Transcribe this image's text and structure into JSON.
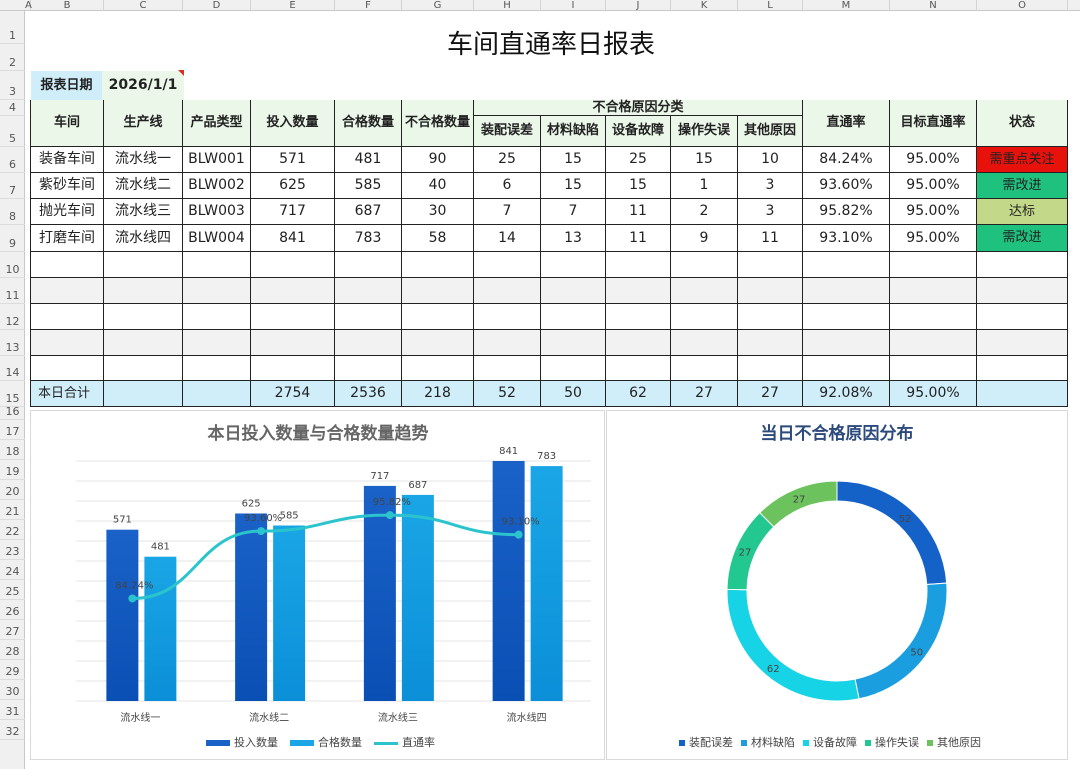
{
  "column_letters": [
    "A",
    "B",
    "C",
    "D",
    "E",
    "F",
    "G",
    "H",
    "I",
    "J",
    "K",
    "L",
    "M",
    "N",
    "O"
  ],
  "row_numbers": [
    "1",
    "2",
    "3",
    "4",
    "5",
    "6",
    "7",
    "8",
    "9",
    "10",
    "11",
    "12",
    "13",
    "14",
    "15",
    "16",
    "17",
    "18",
    "19",
    "20",
    "21",
    "22",
    "23",
    "24",
    "25",
    "26",
    "27",
    "28",
    "29",
    "30",
    "31",
    "32"
  ],
  "title": "车间直通率日报表",
  "report_date_label": "报表日期",
  "report_date_value": "2026/1/1",
  "headers": {
    "workshop": "车间",
    "line": "生产线",
    "product": "产品类型",
    "input": "投入数量",
    "qualified": "合格数量",
    "defect": "不合格数量",
    "reason_group": "不合格原因分类",
    "reasons": [
      "装配误差",
      "材料缺陷",
      "设备故障",
      "操作失误",
      "其他原因"
    ],
    "fpy": "直通率",
    "target": "目标直通率",
    "status": "状态"
  },
  "rows": [
    {
      "workshop": "装备车间",
      "line": "流水线一",
      "product": "BLW001",
      "input": "571",
      "qualified": "481",
      "defect": "90",
      "r1": "25",
      "r2": "15",
      "r3": "25",
      "r4": "15",
      "r5": "10",
      "fpy": "84.24%",
      "target": "95.00%",
      "status": "需重点关注",
      "status_color": "#e8120c"
    },
    {
      "workshop": "紫砂车间",
      "line": "流水线二",
      "product": "BLW002",
      "input": "625",
      "qualified": "585",
      "defect": "40",
      "r1": "6",
      "r2": "15",
      "r3": "15",
      "r4": "1",
      "r5": "3",
      "fpy": "93.60%",
      "target": "95.00%",
      "status": "需改进",
      "status_color": "#1fc17e"
    },
    {
      "workshop": "抛光车间",
      "line": "流水线三",
      "product": "BLW003",
      "input": "717",
      "qualified": "687",
      "defect": "30",
      "r1": "7",
      "r2": "7",
      "r3": "11",
      "r4": "2",
      "r5": "3",
      "fpy": "95.82%",
      "target": "95.00%",
      "status": "达标",
      "status_color": "#c4d88a"
    },
    {
      "workshop": "打磨车间",
      "line": "流水线四",
      "product": "BLW004",
      "input": "841",
      "qualified": "783",
      "defect": "58",
      "r1": "14",
      "r2": "13",
      "r3": "11",
      "r4": "9",
      "r5": "11",
      "fpy": "93.10%",
      "target": "95.00%",
      "status": "需改进",
      "status_color": "#1fc17e"
    }
  ],
  "total": {
    "label": "本日合计",
    "input": "2754",
    "qualified": "2536",
    "defect": "218",
    "r1": "52",
    "r2": "50",
    "r3": "62",
    "r4": "27",
    "r5": "27",
    "fpy": "92.08%",
    "target": "95.00%"
  },
  "chart_data": [
    {
      "type": "bar",
      "title": "本日投入数量与合格数量趋势",
      "categories": [
        "流水线一",
        "流水线二",
        "流水线三",
        "流水线四"
      ],
      "series": [
        {
          "name": "投入数量",
          "values": [
            571,
            625,
            717,
            841
          ],
          "color": "#1a62c8"
        },
        {
          "name": "合格数量",
          "values": [
            481,
            585,
            687,
            783
          ],
          "color": "#1aa6e6"
        },
        {
          "name": "直通率",
          "type": "line",
          "values": [
            84.24,
            93.6,
            95.82,
            93.1
          ],
          "labels": [
            "84.24%",
            "93.60%",
            "95.82%",
            "93.10%"
          ],
          "color": "#2cc4cc"
        }
      ],
      "ylim": [
        0,
        800
      ],
      "grid": true,
      "legend": "bottom"
    },
    {
      "type": "pie",
      "title": "当日不合格原因分布",
      "categories": [
        "装配误差",
        "材料缺陷",
        "设备故障",
        "操作失误",
        "其他原因"
      ],
      "values": [
        52,
        50,
        62,
        27,
        27
      ],
      "colors": [
        "#1462c8",
        "#1a9ee0",
        "#17d3e6",
        "#22c890",
        "#6cc25c"
      ],
      "legend": "bottom"
    }
  ]
}
